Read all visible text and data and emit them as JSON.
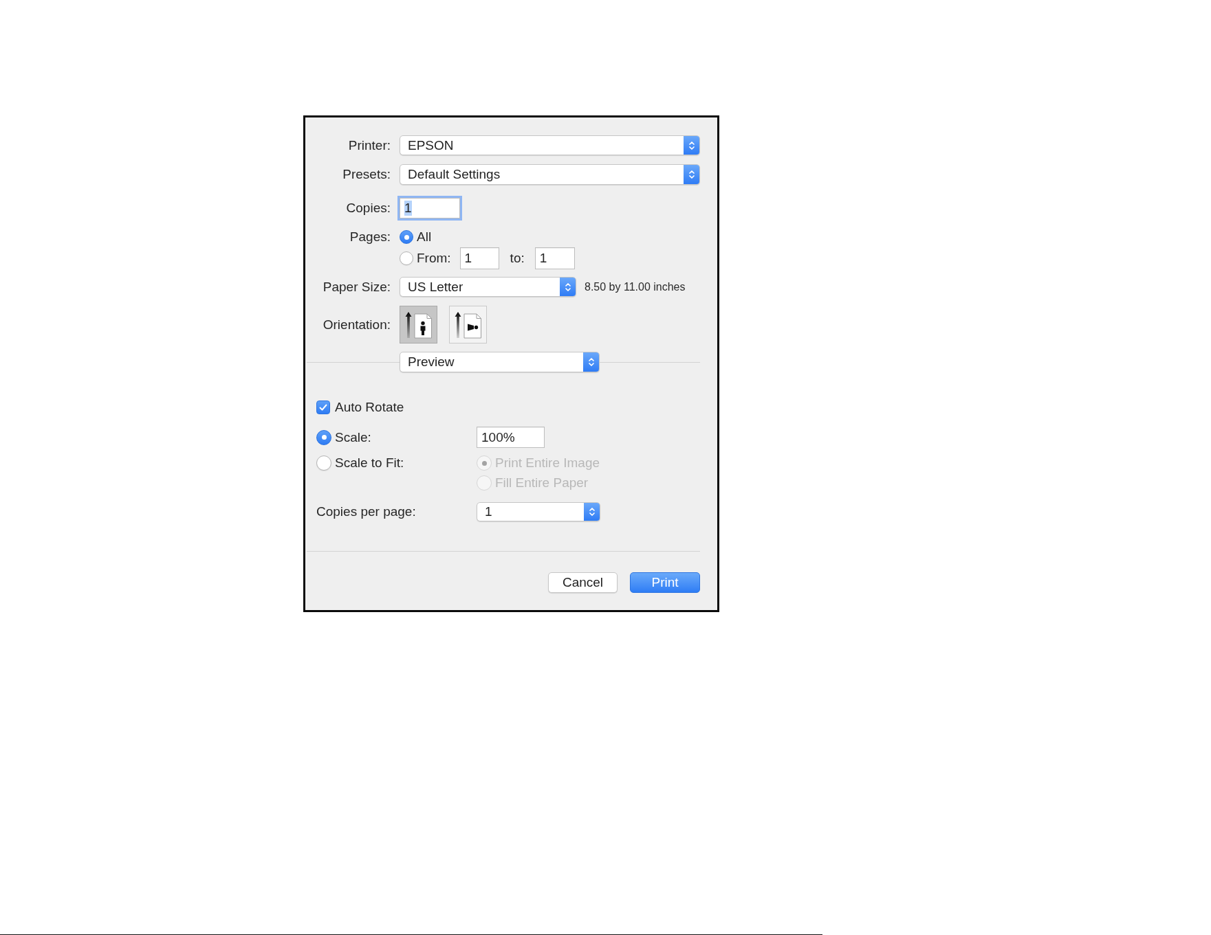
{
  "dialog": {
    "printer": {
      "label": "Printer:",
      "value": "EPSON"
    },
    "presets": {
      "label": "Presets:",
      "value": "Default Settings"
    },
    "copies": {
      "label": "Copies:",
      "value": "1",
      "focused": true,
      "text_selected": true
    },
    "pages": {
      "label": "Pages:",
      "options": [
        {
          "label": "All",
          "selected": true
        },
        {
          "label": "From:",
          "selected": false
        }
      ],
      "from": "1",
      "to_label": "to:",
      "to": "1"
    },
    "paper_size": {
      "label": "Paper Size:",
      "value": "US Letter",
      "dimensions": "8.50 by 11.00 inches"
    },
    "orientation": {
      "label": "Orientation:",
      "options": [
        {
          "kind": "portrait",
          "selected": true
        },
        {
          "kind": "landscape",
          "selected": false
        }
      ]
    },
    "panel_menu": {
      "value": "Preview"
    },
    "auto_rotate": {
      "label": "Auto Rotate",
      "checked": true
    },
    "scaling": {
      "options": [
        {
          "label": "Scale:",
          "selected": true
        },
        {
          "label": "Scale to Fit:",
          "selected": false
        }
      ],
      "scale": "100%",
      "fit_options": [
        {
          "label": "Print Entire Image",
          "selected": true,
          "disabled": true
        },
        {
          "label": "Fill Entire Paper",
          "selected": false,
          "disabled": true
        }
      ]
    },
    "copies_per_page": {
      "label": "Copies per page:",
      "value": "1"
    },
    "buttons": [
      {
        "label": "Cancel",
        "kind": "secondary"
      },
      {
        "label": "Print",
        "kind": "primary"
      }
    ]
  }
}
